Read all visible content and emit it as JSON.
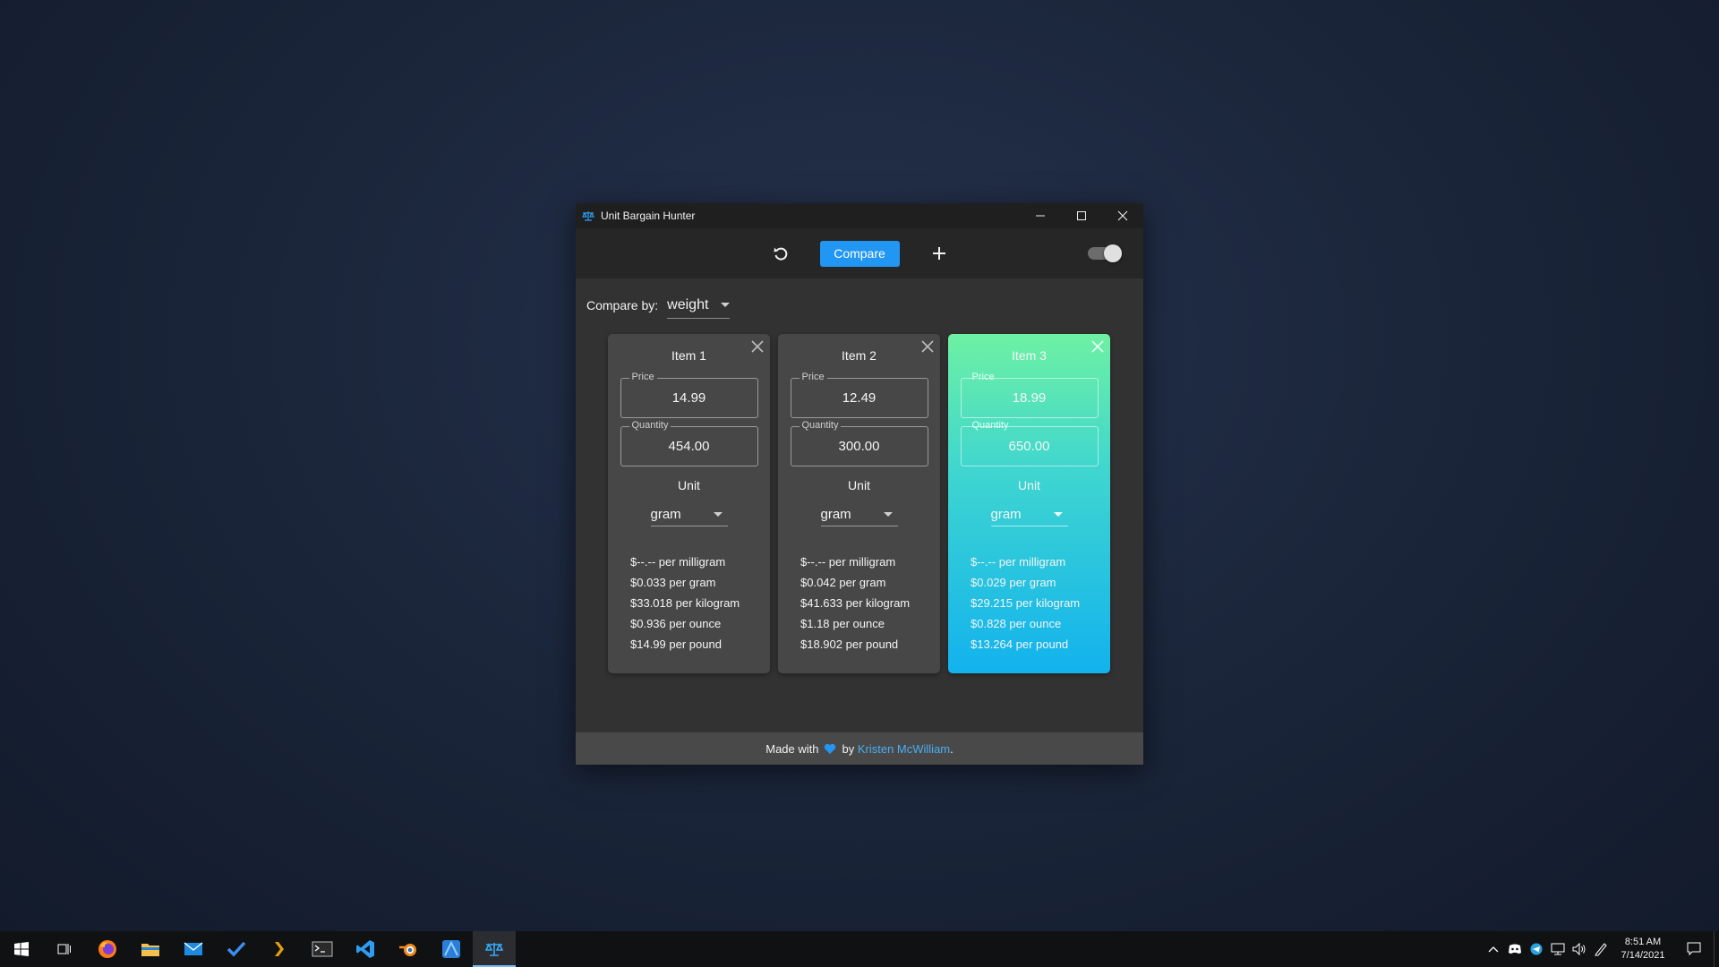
{
  "window": {
    "title": "Unit Bargain Hunter",
    "minimize_label": "minimize",
    "maximize_label": "maximize",
    "close_label": "close"
  },
  "toolbar": {
    "reset_icon": "reset-icon",
    "compare_label": "Compare",
    "add_icon": "plus-icon",
    "dark_mode_toggle": "on"
  },
  "compare_by": {
    "label": "Compare by:",
    "value": "weight"
  },
  "items": [
    {
      "title": "Item 1",
      "price_label": "Price",
      "price": "14.99",
      "quantity_label": "Quantity",
      "quantity": "454.00",
      "unit_label": "Unit",
      "unit": "gram",
      "best": false,
      "rates": [
        "$--.-- per milligram",
        "$0.033 per gram",
        "$33.018 per kilogram",
        "$0.936 per ounce",
        "$14.99 per pound"
      ]
    },
    {
      "title": "Item 2",
      "price_label": "Price",
      "price": "12.49",
      "quantity_label": "Quantity",
      "quantity": "300.00",
      "unit_label": "Unit",
      "unit": "gram",
      "best": false,
      "rates": [
        "$--.-- per milligram",
        "$0.042 per gram",
        "$41.633 per kilogram",
        "$1.18 per ounce",
        "$18.902 per pound"
      ]
    },
    {
      "title": "Item 3",
      "price_label": "Price",
      "price": "18.99",
      "quantity_label": "Quantity",
      "quantity": "650.00",
      "unit_label": "Unit",
      "unit": "gram",
      "best": true,
      "rates": [
        "$--.-- per milligram",
        "$0.029 per gram",
        "$29.215 per kilogram",
        "$0.828 per ounce",
        "$13.264 per pound"
      ]
    }
  ],
  "footer": {
    "made_with": "Made with",
    "by": "by",
    "author": "Kristen McWilliam",
    "period": "."
  },
  "colors": {
    "accent": "#2196f3",
    "best_gradient_top": "#6ef1a3",
    "best_gradient_bottom": "#12b2ee",
    "heart": "#2196f3"
  },
  "taskbar": {
    "apps": [
      "windows-start-icon",
      "task-view-icon",
      "firefox-icon",
      "file-explorer-icon",
      "mail-icon",
      "todo-icon",
      "plex-icon",
      "terminal-icon",
      "vscode-icon",
      "blender-icon",
      "affinity-icon",
      "unit-bargain-hunter-icon"
    ],
    "time": "8:51 AM",
    "date": "7/14/2021"
  }
}
